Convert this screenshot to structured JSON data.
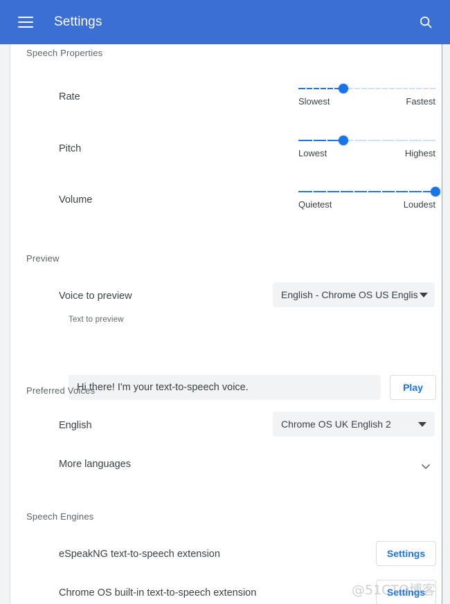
{
  "appbar": {
    "menu_icon": "hamburger-menu-icon",
    "title": "Settings",
    "search_icon": "search-icon"
  },
  "colors": {
    "appbar_blue": "#3b6fd4",
    "accent_blue": "#1a73e8",
    "track_inactive": "#cfe0fb",
    "field_gray": "#f1f3f4",
    "label_gray": "#5f6368",
    "text_dark": "#3c4043"
  },
  "sections": {
    "speech_properties": {
      "heading": "Speech Properties",
      "sliders": [
        {
          "label": "Rate",
          "min_label": "Slowest",
          "max_label": "Fastest",
          "value_pct": 33,
          "ticks": 21
        },
        {
          "label": "Pitch",
          "min_label": "Lowest",
          "max_label": "Highest",
          "value_pct": 33,
          "ticks": 11
        },
        {
          "label": "Volume",
          "min_label": "Quietest",
          "max_label": "Loudest",
          "value_pct": 100,
          "ticks": 11
        }
      ]
    },
    "preview": {
      "heading": "Preview",
      "voice_row_label": "Voice to preview",
      "voice_selected": "English - Chrome OS US English",
      "text_sub_label": "Text to preview",
      "text_value": "Hi there! I'm your text-to-speech voice.",
      "text_placeholder": "Text to preview",
      "play_label": "Play"
    },
    "preferred_voices": {
      "heading": "Preferred Voices",
      "english_row_label": "English",
      "english_selected": "Chrome OS UK English 2",
      "more_languages_label": "More languages",
      "more_languages_icon": "chevron-down-icon"
    },
    "speech_engines": {
      "heading": "Speech Engines",
      "engines": [
        {
          "name": "eSpeakNG text-to-speech extension",
          "button_label": "Settings"
        },
        {
          "name": "Chrome OS built-in text-to-speech extension",
          "button_label": "Settings"
        }
      ]
    }
  },
  "watermark": "@51CTO博客"
}
